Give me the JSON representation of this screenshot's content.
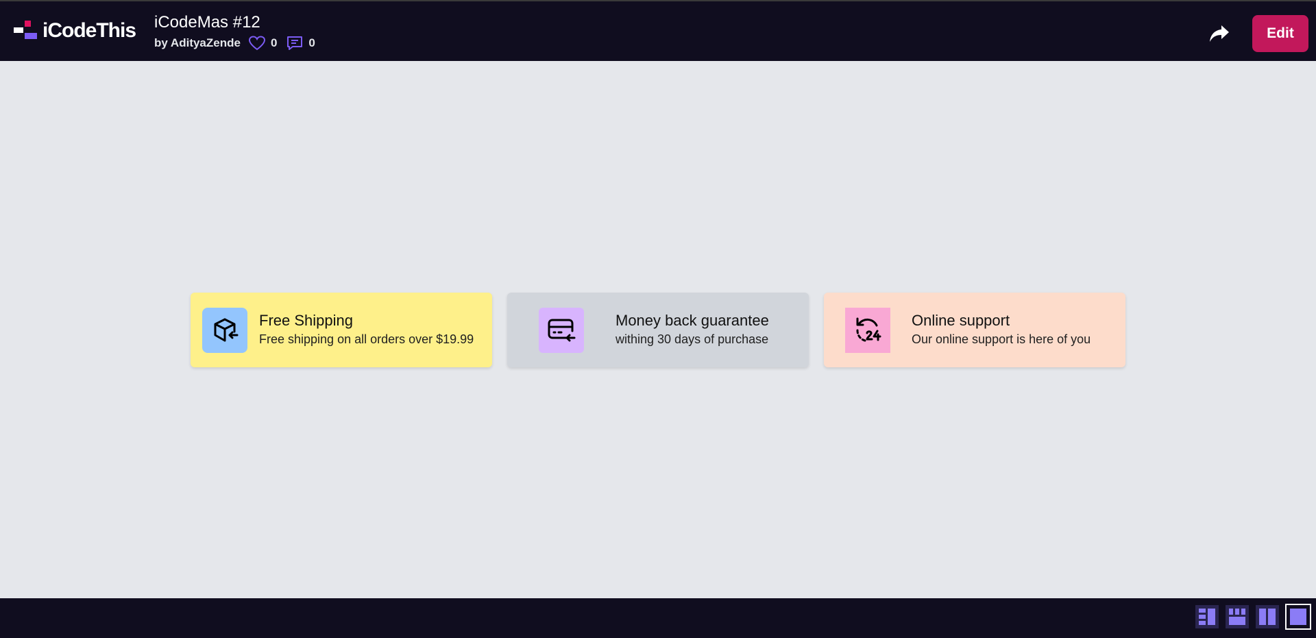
{
  "header": {
    "logo_text": "iCodeThis",
    "title": "iCodeMas #12",
    "author": "by AdityaZende",
    "likes": "0",
    "comments": "0",
    "edit_label": "Edit"
  },
  "cards": [
    {
      "title": "Free Shipping",
      "description": "Free shipping on all orders over $19.99",
      "icon": "package-return-icon",
      "bg": "#fef08a",
      "icon_bg": "#93c5fd"
    },
    {
      "title": "Money back guarantee",
      "description": "withing 30 days of purchase",
      "icon": "credit-card-refund-icon",
      "bg": "#d1d5db",
      "icon_bg": "#d8b4fe"
    },
    {
      "title": "Online support",
      "description": "Our online support is here of you",
      "icon": "support-24-icon",
      "bg": "#fddccb",
      "icon_bg": "#f9a8d4"
    }
  ],
  "footer": {
    "view_buttons": [
      "layout-split-icon",
      "layout-grid-icon",
      "layout-columns-icon",
      "layout-full-icon"
    ],
    "active_view": "layout-full-icon"
  },
  "colors": {
    "bar_bg": "#100d1f",
    "page_bg": "#e5e7eb",
    "accent": "#c2185b",
    "purple": "#7c5cf5"
  }
}
